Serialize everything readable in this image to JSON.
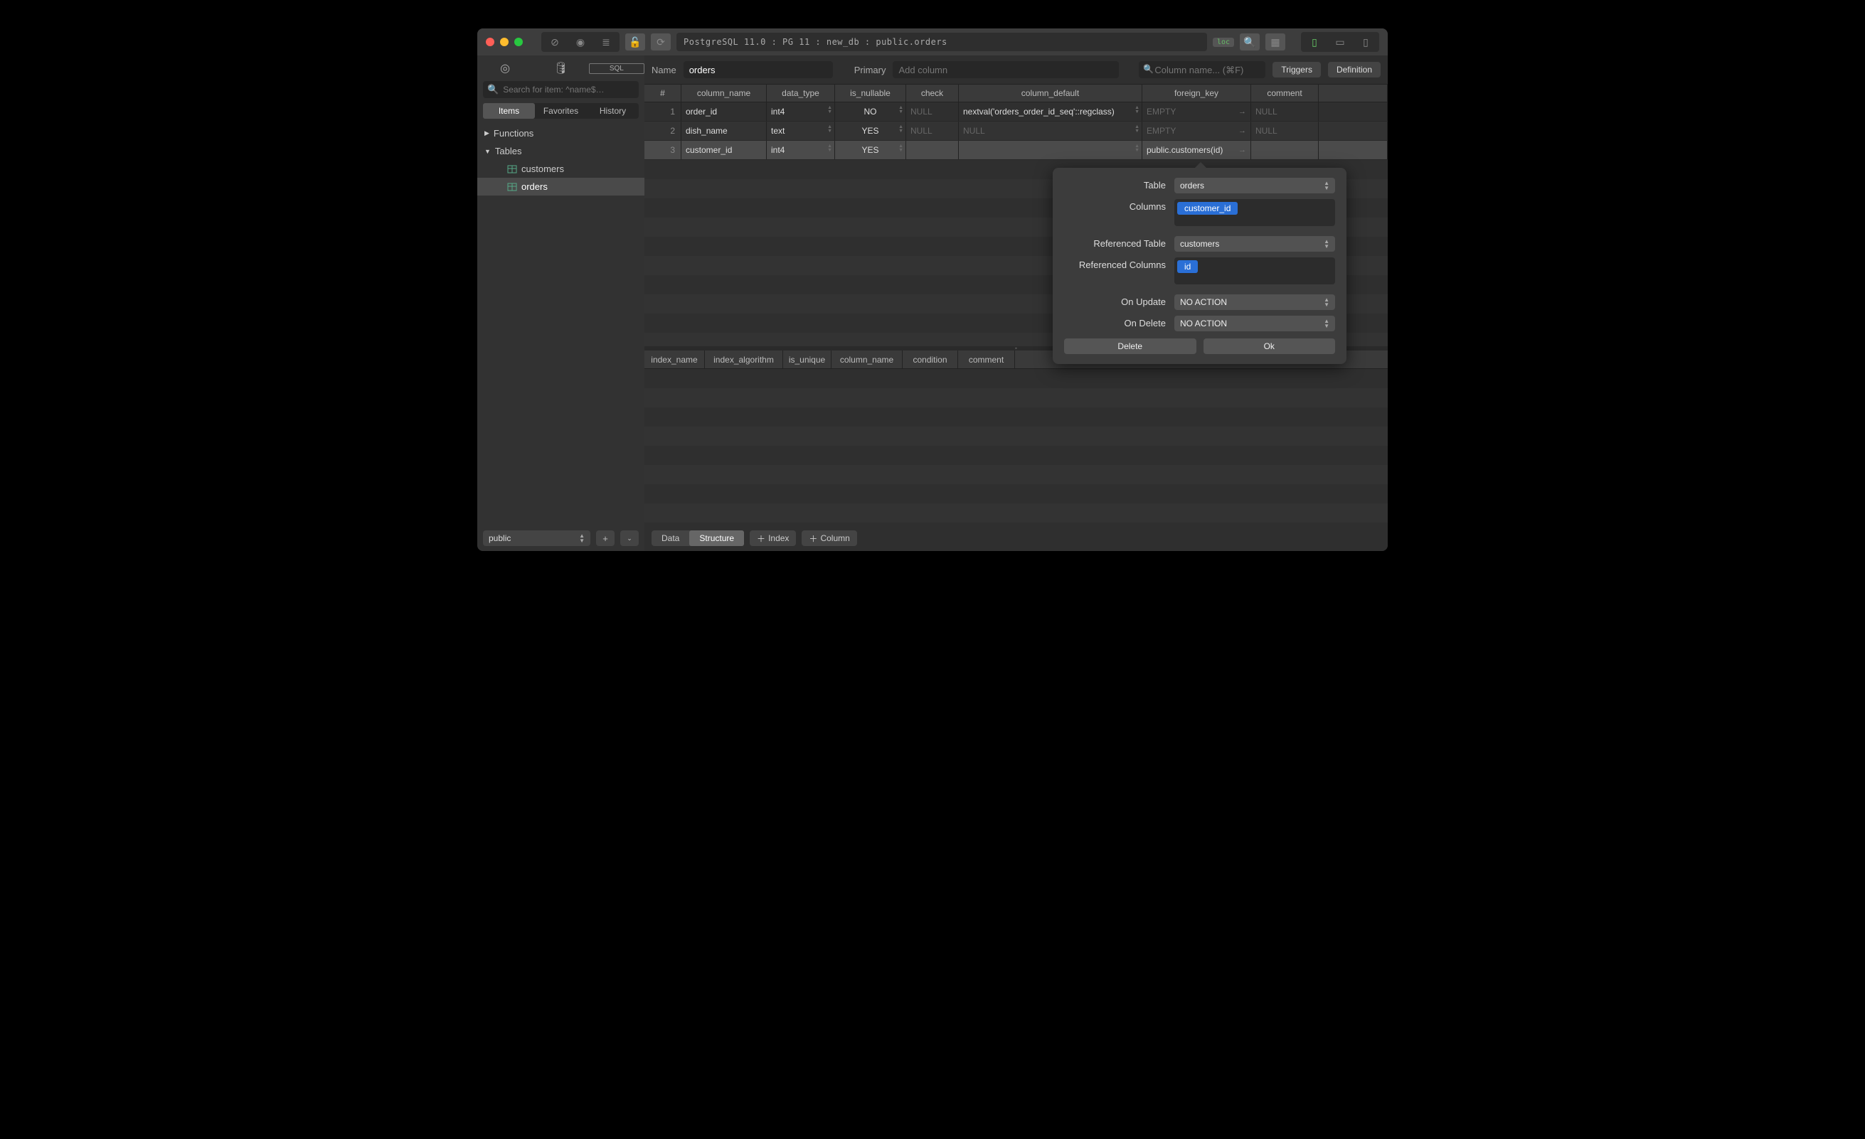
{
  "breadcrumb": "PostgreSQL 11.0 : PG 11 : new_db : public.orders",
  "loc_badge": "loc",
  "sidebar": {
    "search_placeholder": "Search for item: ^name$…",
    "tabs": [
      "Items",
      "Favorites",
      "History"
    ],
    "tab_active": 0,
    "tree": {
      "functions": "Functions",
      "tables": "Tables",
      "items": [
        "customers",
        "orders"
      ],
      "selected": 1
    },
    "schema": "public"
  },
  "header": {
    "name_label": "Name",
    "name_value": "orders",
    "primary_label": "Primary",
    "primary_placeholder": "Add column",
    "column_search_placeholder": "Column name... (⌘F)",
    "triggers_btn": "Triggers",
    "definition_btn": "Definition"
  },
  "columns_header": [
    "#",
    "column_name",
    "data_type",
    "is_nullable",
    "check",
    "column_default",
    "foreign_key",
    "comment"
  ],
  "columns": [
    {
      "n": 1,
      "name": "order_id",
      "type": "int4",
      "nullable": "NO",
      "check": "NULL",
      "default": "nextval('orders_order_id_seq'::regclass)",
      "fk": "EMPTY",
      "comment": "NULL",
      "selected": false
    },
    {
      "n": 2,
      "name": "dish_name",
      "type": "text",
      "nullable": "YES",
      "check": "NULL",
      "default": "NULL",
      "fk": "EMPTY",
      "comment": "NULL",
      "selected": false
    },
    {
      "n": 3,
      "name": "customer_id",
      "type": "int4",
      "nullable": "YES",
      "check": "",
      "default": "",
      "fk": "public.customers(id)",
      "comment": "",
      "selected": true
    }
  ],
  "indexes_header": [
    "index_name",
    "index_algorithm",
    "is_unique",
    "column_name",
    "condition",
    "comment"
  ],
  "footer": {
    "data": "Data",
    "structure": "Structure",
    "index_btn": "Index",
    "column_btn": "Column"
  },
  "popover": {
    "table_label": "Table",
    "table_value": "orders",
    "columns_label": "Columns",
    "columns_tag": "customer_id",
    "ref_table_label": "Referenced Table",
    "ref_table_value": "customers",
    "ref_columns_label": "Referenced Columns",
    "ref_columns_tag": "id",
    "on_update_label": "On Update",
    "on_update_value": "NO ACTION",
    "on_delete_label": "On Delete",
    "on_delete_value": "NO ACTION",
    "delete_btn": "Delete",
    "ok_btn": "Ok"
  }
}
